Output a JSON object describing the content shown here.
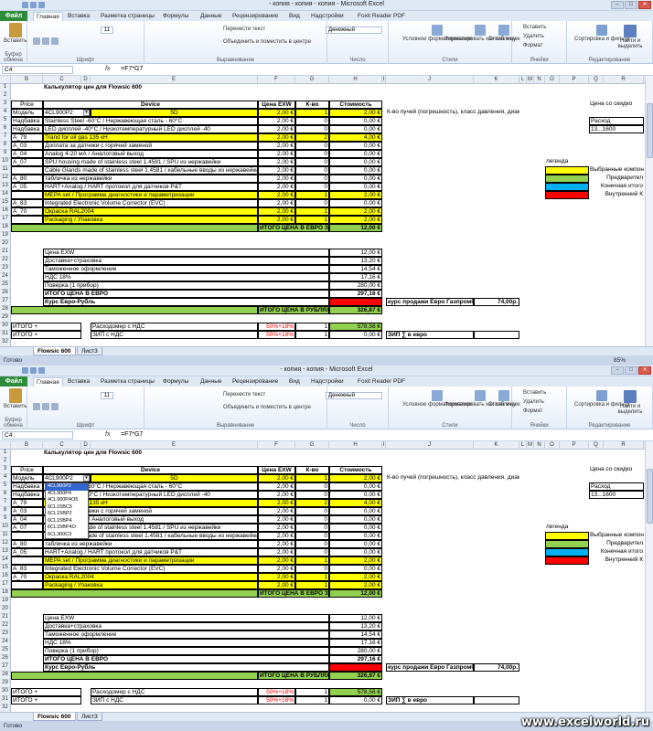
{
  "panes": [
    {
      "title": "- копия - копия - копия - Microsoft Excel",
      "cell_ref": "C4",
      "dropdown_open": false
    },
    {
      "title": "- копия - копия - Microsoft Excel",
      "cell_ref": "C4",
      "dropdown_open": true
    }
  ],
  "ribbon": {
    "file": "Файл",
    "tabs": [
      "Главная",
      "Вставка",
      "Разметка страницы",
      "Формулы",
      "Данные",
      "Рецензирование",
      "Вид",
      "Надстройки",
      "Foxit Reader PDF"
    ],
    "groups": [
      "Буфер обмена",
      "Шрифт",
      "Выравнивание",
      "Число",
      "Стили",
      "Ячейки",
      "Редактирование"
    ],
    "paste": "Вставить",
    "wrap": "Перенести текст",
    "merge": "Объединить и поместить в центре",
    "number_format": "Денежный",
    "cond_format": "Условное форматирование",
    "format_table": "Форматировать как таблицу",
    "cell_styles": "Стили ячеек",
    "insert": "Вставить",
    "delete": "Удалить",
    "format": "Формат",
    "sort": "Сортировка и фильтр",
    "find": "Найти и выделить",
    "font_size": "11"
  },
  "formula": {
    "fx": "fx",
    "value": "=F7*G7"
  },
  "columns": [
    "B",
    "C",
    "D",
    "E",
    "F",
    "G",
    "H",
    "I",
    "J",
    "K",
    "L",
    "M",
    "N",
    "O",
    "P",
    "Q",
    "R"
  ],
  "sheet": {
    "title": "Калькулятор цен для Flowsic 600",
    "headers": {
      "price": "Price",
      "device": "Device",
      "price_exw": "Цена EXW",
      "qty": "К-во",
      "cost": "Стоимость"
    },
    "rows": [
      {
        "n": "4",
        "b": "Модель",
        "c": "4CL900P2",
        "e": "5D",
        "f": "2,00 €",
        "g": "1",
        "h": "2,00 €",
        "style": "yellow"
      },
      {
        "n": "5",
        "b": "Надбавка",
        "c": "Stainless Steel -60°C / Нержавеющая сталь - 60°C",
        "f": "2,00 €",
        "g": "0",
        "h": "0,00 €"
      },
      {
        "n": "6",
        "b": "Надбавка",
        "c": "LED дисплей -40°C / Низкотемпературный LED дисплей -40",
        "f": "2,00 €",
        "g": "0",
        "h": "0,00 €"
      },
      {
        "n": "7",
        "b": "A_79",
        "c": "Trand for oil gas 135 кН",
        "f": "2,00 €",
        "g": "2",
        "h": "4,00 €",
        "style": "yellow"
      },
      {
        "n": "8",
        "b": "A_03",
        "c": "Доплата за датчики с горячей заменой",
        "f": "2,00 €",
        "g": "0",
        "h": "0,00 €"
      },
      {
        "n": "9",
        "b": "A_04",
        "c": "Analog 4-20 мА / Аналоговый выход",
        "f": "2,00 €",
        "g": "0",
        "h": "0,00 €"
      },
      {
        "n": "10",
        "b": "A_07",
        "c": "SPU housing made of stainless steel 1.4581 / SPU из нержавейки",
        "f": "2,00 €",
        "g": "0",
        "h": "0,00 €"
      },
      {
        "n": "11",
        "b": "",
        "c": "Cable Glands made of stainless steel 1.4581 / кабельные вводы из нержавейки",
        "f": "2,00 €",
        "g": "0",
        "h": "0,00 €"
      },
      {
        "n": "12",
        "b": "A_80",
        "c": "табличка из нержавейки",
        "f": "2,00 €",
        "g": "0",
        "h": "0,00 €"
      },
      {
        "n": "13",
        "b": "A_05",
        "c": "HART+Analog / HART протокол для датчиков P&T",
        "f": "2,00 €",
        "g": "0",
        "h": "0,00 €"
      },
      {
        "n": "14",
        "b": "",
        "c": "MEPA set / Программа диагностики и параметризации",
        "f": "2,00 €",
        "g": "1",
        "h": "2,00 €",
        "style": "yellow"
      },
      {
        "n": "15",
        "b": "A_83",
        "c": "Integrated Electronic Volume Corrector (EVC)",
        "f": "2,00 €",
        "g": "0",
        "h": "0,00 €"
      },
      {
        "n": "16",
        "b": "A_70",
        "c": "Окраска RAL2004",
        "f": "2,00 €",
        "g": "1",
        "h": "2,00 €",
        "style": "yellow"
      },
      {
        "n": "17",
        "b": "",
        "c": "Packaging / Упаковка",
        "f": "2,00 €",
        "g": "1",
        "h": "2,00 €",
        "style": "yellow"
      }
    ],
    "total_row": {
      "n": "18",
      "label": "ИТОГО ЦЕНА В ЕВРО ЗА РАСХОДОМЕР",
      "value": "12,00 €"
    },
    "summary": [
      {
        "n": "21",
        "label": "Цена EXW",
        "value": "12,00 €"
      },
      {
        "n": "22",
        "label": "Доставка+страховка",
        "value": "13,20 €"
      },
      {
        "n": "23",
        "label": "Таможенное оформление",
        "value": "14,54 €"
      },
      {
        "n": "24",
        "label": "НДС 18%",
        "value": "17,16 €"
      },
      {
        "n": "25",
        "label": "Поверка (1 прибор)",
        "value": "280,00 €"
      },
      {
        "n": "26",
        "label": "ИТОГО ЦЕНА В ЕВРО",
        "value": "297,16 €",
        "bold": true
      },
      {
        "n": "27",
        "label": "Курс Евро-Рубль",
        "value": "",
        "bold": true,
        "red": true
      }
    ],
    "rub_row": {
      "n": "28",
      "label": "ИТОГО ЦЕНА В РУБЛЯХ ЗА РАСХОДОМЕР",
      "value": "326,87 €"
    },
    "itogo": [
      {
        "n": "30",
        "b": "ИТОГО +",
        "d": "Расходомер с НДС",
        "f": "50%+18%",
        "g": "1",
        "h": "578,56 €",
        "green": true
      },
      {
        "n": "31",
        "b": "ИТОГО +",
        "d": "ЗИП с НДС",
        "f": "50%+18%",
        "g": "1",
        "h": "0,00 €"
      }
    ],
    "side_note": "К-во пучей (погрешность), класс давления, диаметр",
    "euro_label": "курс продажи Евро Газпромбанк",
    "euro_value": "74,00р.",
    "zip_label": "ЗИП ∑ в евро",
    "r_price": "Цена со скидко",
    "rashod": "Расход",
    "range": "13...1600",
    "legend": {
      "title": "легенда",
      "items": [
        {
          "label": "Выбранные компонен",
          "color": "#ffff00"
        },
        {
          "label": "Предварител",
          "color": "#92d050"
        },
        {
          "label": "Конечная итого",
          "color": "#00b0f0"
        },
        {
          "label": "Внутренний К",
          "color": "#ff0000"
        }
      ]
    }
  },
  "dropdown_items": [
    "4CL900P2",
    "4CL900P4",
    "4CL900P4O5",
    "6CL15BC5",
    "6CL15BP2",
    "6CL15BP4",
    "6CL15BP4O",
    "6CL300C3"
  ],
  "sheet_tabs": [
    "Flowsic 600",
    "Лист3"
  ],
  "status": "Готово",
  "zoom": "85%",
  "watermark": "www.excelworld.ru"
}
